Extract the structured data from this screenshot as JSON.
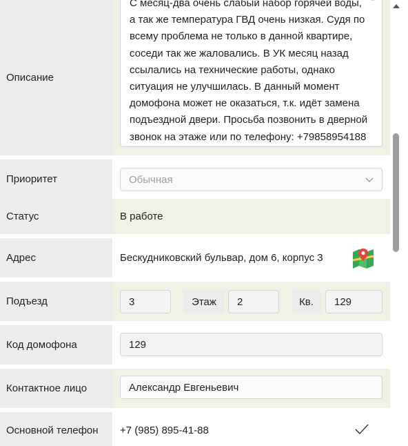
{
  "form": {
    "description": {
      "label": "Описание",
      "lines": [
        "С месяц-два очень слабый набор горячей воды,",
        "а так же температура ГВД очень низкая. Судя по",
        "всему проблема не только в данной квартире,",
        "соседи так же жаловались. В УК месяц назад",
        "ссылались на технические работы, однако",
        "ситуация не улучшилась.  В данный момент",
        "домофона может не оказаться, т.к. идёт замена",
        "подъездной двери. Просьба позвонить в дверной",
        "звонок на этаже или по телефону: +79858954188"
      ]
    },
    "priority": {
      "label": "Приоритет",
      "value": "Обычная",
      "icon": "chevron-down-icon"
    },
    "status": {
      "label": "Статус",
      "value": "В работе"
    },
    "address": {
      "label": "Адрес",
      "value": "Бескудниковский бульвар, дом 6, корпус 3",
      "icon": "map-icon"
    },
    "entrance": {
      "label": "Подъезд",
      "value": "3",
      "floor_label": "Этаж",
      "floor_value": "2",
      "apt_label": "Кв.",
      "apt_value": "129"
    },
    "intercom": {
      "label": "Код домофона",
      "value": "129"
    },
    "contact": {
      "label": "Контактное лицо",
      "value": "Александр Евгеньевич"
    },
    "phone": {
      "label": "Основной телефон",
      "value": "+7 (985) 895-41-88",
      "icon": "checkmark-icon"
    }
  },
  "colors": {
    "label_bg": "#ededed",
    "green_bg": "#eef3e6",
    "map_green": "#3aa655",
    "map_pin": "#e2463a"
  }
}
